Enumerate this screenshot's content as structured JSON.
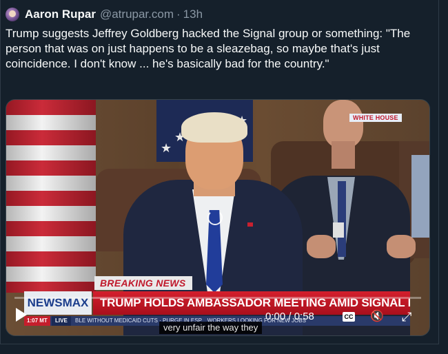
{
  "tweet": {
    "author_name": "Aaron Rupar",
    "handle": "@atrupar.com",
    "separator": "·",
    "time": "13h",
    "text": "Trump suggests Jeffrey Goldberg hacked the Signal group or something: \"The person that was on just happens to be a sleazebag, so maybe that's just coincidence. I don't know ... he's basically bad for the country.\""
  },
  "video": {
    "watermark": "WHITE HOUSE",
    "breaking_label": "BREAKING NEWS",
    "network": "NEWSMAX",
    "headline": "TRUMP HOLDS AMBASSADOR MEETING AMID SIGNAL FALLOUT",
    "clock": "1:07 MT",
    "live": "LIVE",
    "ticker": "BLE WITHOUT MEDICAID CUTS · PURGE IN ESP... WORKERS LOOKING FOR NEW JOBS",
    "time_display": "0:00 / 0:58",
    "progress_fraction": 0.0,
    "cc_label": "CC",
    "caption": "very unfair the way they",
    "icons": {
      "play": "play-icon",
      "loading": "loading-spinner-icon",
      "mute": "muted-speaker-icon",
      "fullscreen": "fullscreen-icon"
    }
  },
  "colors": {
    "background": "#15202b",
    "text": "#f7f9f9",
    "secondary_text": "#8b98a5",
    "newsmax_red": "#c8202f",
    "newsmax_blue": "#1b3d8c"
  }
}
